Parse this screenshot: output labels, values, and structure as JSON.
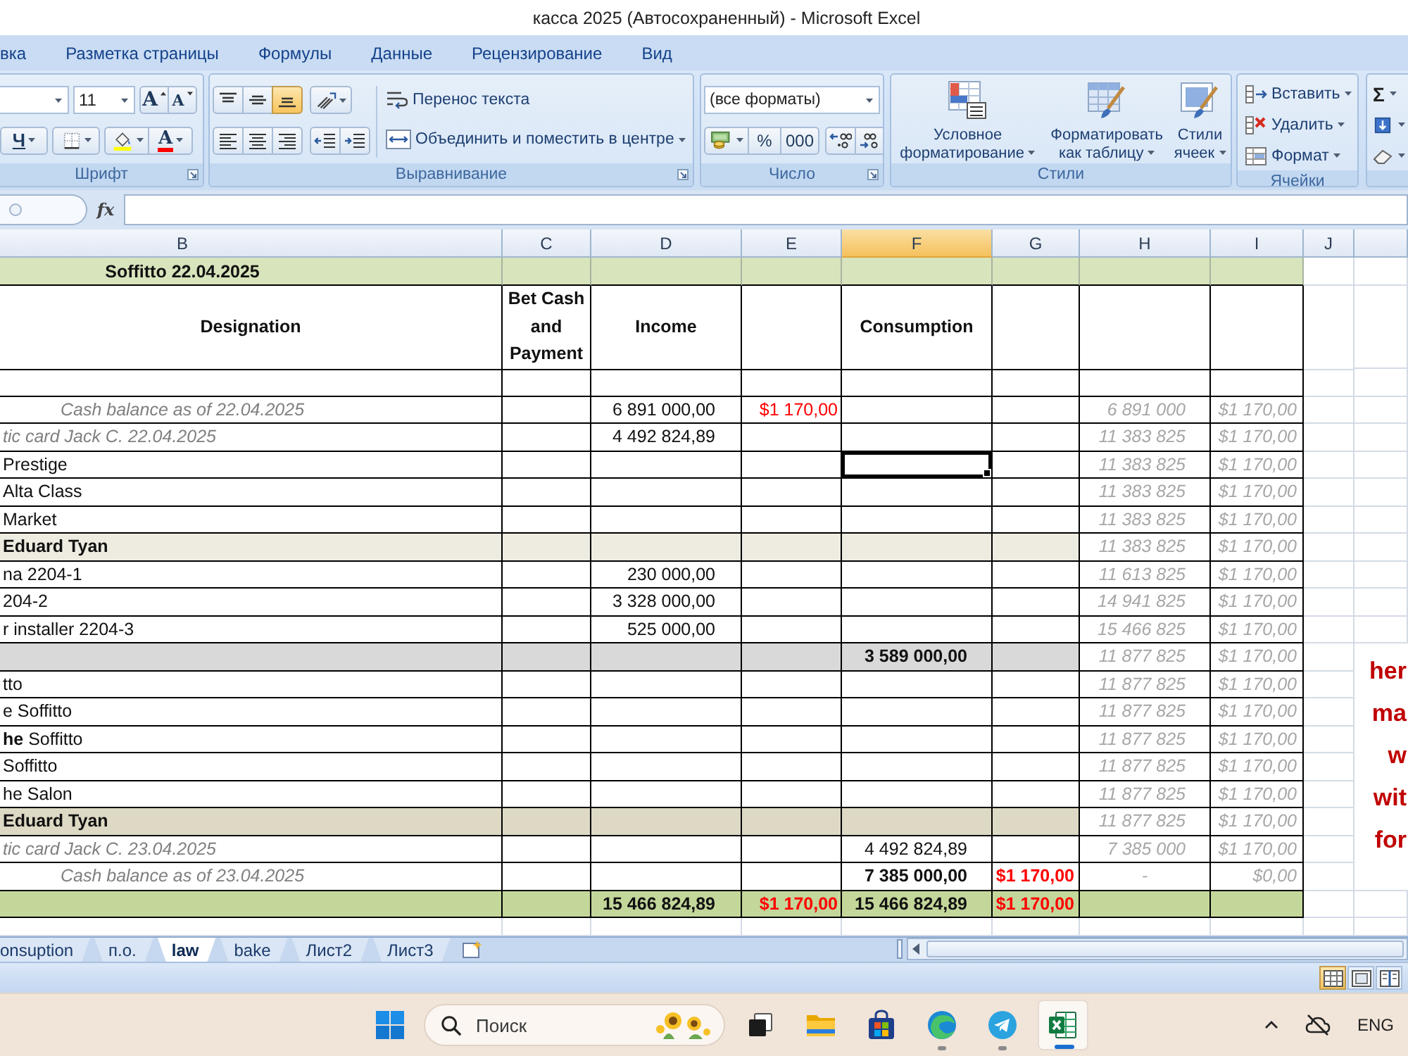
{
  "window": {
    "title": "касса 2025 (Автосохраненный) - Microsoft Excel"
  },
  "ribbon_tabs": [
    {
      "label": "вка",
      "selected": false
    },
    {
      "label": "Разметка страницы",
      "selected": false
    },
    {
      "label": "Формулы",
      "selected": false
    },
    {
      "label": "Данные",
      "selected": false
    },
    {
      "label": "Рецензирование",
      "selected": false
    },
    {
      "label": "Вид",
      "selected": false
    }
  ],
  "ribbon": {
    "font_group": {
      "label": "Шрифт",
      "size": "11",
      "grow_button": "A",
      "shrink_button": "A",
      "underline_button": "Ч",
      "font_color_button": "A"
    },
    "alignment_group": {
      "label": "Выравнивание",
      "vertical_buttons": [
        {
          "kind": "top",
          "selected": false
        },
        {
          "kind": "middle",
          "selected": false
        },
        {
          "kind": "bottom",
          "selected": true
        }
      ],
      "wrap_text": "Перенос текста",
      "merge": "Объединить и поместить в центре"
    },
    "number_group": {
      "label": "Число",
      "format": "(все форматы)",
      "percent_button": "%",
      "thousands_button": "000"
    },
    "styles_group": {
      "label": "Стили",
      "buttons": [
        {
          "kind": "conditional",
          "label": "Условное форматирование"
        },
        {
          "kind": "table",
          "label": "Форматировать как таблицу"
        },
        {
          "kind": "cell",
          "label": "Стили ячеек"
        }
      ]
    },
    "cells_group": {
      "label": "Ячейки",
      "buttons": [
        {
          "kind": "insert",
          "label": "Вставить"
        },
        {
          "kind": "delete",
          "label": "Удалить"
        },
        {
          "kind": "format",
          "label": "Формат"
        }
      ]
    },
    "editing_group": {
      "sum_button": "Σ"
    }
  },
  "formula_bar": {
    "function_button": "fx"
  },
  "sheet": {
    "columns": [
      {
        "label": "B",
        "selected": false
      },
      {
        "label": "C",
        "selected": false
      },
      {
        "label": "D",
        "selected": false
      },
      {
        "label": "E",
        "selected": false
      },
      {
        "label": "F",
        "selected": true
      },
      {
        "label": "G",
        "selected": false
      },
      {
        "label": "H",
        "selected": false
      },
      {
        "label": "I",
        "selected": false
      },
      {
        "label": "J",
        "selected": false
      }
    ],
    "rows": [
      {
        "kind": "title",
        "color": "#d8e4bc",
        "selected": false,
        "cells": {
          "designation": "Soffitto 22.04.2025"
        }
      },
      {
        "kind": "header",
        "selected": false,
        "cells": {
          "designation": "Designation",
          "bet_cash_and_payment": "Bet Cash and Payment",
          "income": "Income",
          "consumption": "Consumption"
        }
      },
      {
        "kind": "blank",
        "selected": false
      },
      {
        "kind": "opening",
        "selected": false,
        "cells": {
          "designation": "Cash balance as of 22.04.2025",
          "income": "6 891 000,00",
          "column_e": "$1 170,00",
          "column_h": "6 891 000",
          "column_i": "$1 170,00"
        }
      },
      {
        "kind": "card",
        "selected": false,
        "cells": {
          "designation": "tic card Jack C. 22.04.2025",
          "income": "4 492 824,89",
          "column_h": "11 383 825",
          "column_i": "$1 170,00"
        }
      },
      {
        "kind": "item",
        "selected": true,
        "cells": {
          "designation": "Prestige",
          "column_h": "11 383 825",
          "column_i": "$1 170,00"
        }
      },
      {
        "kind": "item",
        "selected": false,
        "cells": {
          "designation": "Alta Class",
          "column_h": "11 383 825",
          "column_i": "$1 170,00"
        }
      },
      {
        "kind": "item",
        "selected": false,
        "cells": {
          "designation": "Market",
          "column_h": "11 383 825",
          "column_i": "$1 170,00"
        }
      },
      {
        "kind": "group",
        "color": "#eeece1",
        "selected": false,
        "cells": {
          "designation": "Eduard Tyan",
          "column_h": "11 383 825",
          "column_i": "$1 170,00"
        }
      },
      {
        "kind": "item",
        "selected": false,
        "cells": {
          "designation": "na 2204-1",
          "income": "230 000,00",
          "column_h": "11 613 825",
          "column_i": "$1 170,00"
        }
      },
      {
        "kind": "item",
        "selected": false,
        "cells": {
          "designation": "204-2",
          "income": "3 328 000,00",
          "column_h": "14 941 825",
          "column_i": "$1 170,00"
        }
      },
      {
        "kind": "item",
        "selected": false,
        "cells": {
          "designation": "r installer 2204-3",
          "income": "525 000,00",
          "column_h": "15 466 825",
          "column_i": "$1 170,00"
        }
      },
      {
        "kind": "subtotal",
        "color": "#d9d9d9",
        "selected": false,
        "cells": {
          "consumption": "3 589 000,00",
          "column_h": "11 877 825",
          "column_i": "$1 170,00"
        }
      },
      {
        "kind": "item",
        "selected": false,
        "cells": {
          "designation": "tto",
          "column_h": "11 877 825",
          "column_i": "$1 170,00"
        }
      },
      {
        "kind": "item",
        "selected": false,
        "cells": {
          "designation": "e Soffitto",
          "column_h": "11 877 825",
          "column_i": "$1 170,00"
        }
      },
      {
        "kind": "item",
        "selected": false,
        "cells": {
          "designation": "**he** Soffitto",
          "column_h": "11 877 825",
          "column_i": "$1 170,00"
        }
      },
      {
        "kind": "item",
        "selected": false,
        "cells": {
          "designation": "Soffitto",
          "column_h": "11 877 825",
          "column_i": "$1 170,00"
        }
      },
      {
        "kind": "item",
        "selected": false,
        "cells": {
          "designation": "he Salon",
          "column_h": "11 877 825",
          "column_i": "$1 170,00"
        }
      },
      {
        "kind": "group",
        "color": "#ddd9c4",
        "selected": false,
        "cells": {
          "designation": "Eduard Tyan",
          "column_h": "11 877 825",
          "column_i": "$1 170,00"
        }
      },
      {
        "kind": "card",
        "selected": false,
        "cells": {
          "designation": "tic card Jack C. 23.04.2025",
          "consumption": "4 492 824,89",
          "column_h": "7 385 000",
          "column_i": "$1 170,00"
        }
      },
      {
        "kind": "closing",
        "selected": false,
        "cells": {
          "designation": "Cash balance as of 23.04.2025",
          "consumption": "7 385 000,00",
          "column_g": "$1 170,00",
          "column_h": "-",
          "column_i": "$0,00"
        }
      },
      {
        "kind": "total",
        "color": "#c4d79b",
        "selected": false,
        "cells": {
          "income": "15 466 824,89",
          "column_e": "$1 170,00",
          "consumption": "15 466 824,89",
          "column_g": "$1 170,00"
        }
      }
    ],
    "side_note": [
      "her",
      "ma",
      "w",
      "wit",
      "for"
    ]
  },
  "sheet_tabs": [
    {
      "label": "onsuption",
      "selected": false
    },
    {
      "label": "п.о.",
      "selected": false
    },
    {
      "label": "law",
      "selected": true
    },
    {
      "label": "bake",
      "selected": false
    },
    {
      "label": "Лист2",
      "selected": false
    },
    {
      "label": "Лист3",
      "selected": false
    }
  ],
  "status_bar": {
    "view_buttons": [
      {
        "kind": "normal",
        "selected": true
      },
      {
        "kind": "page_layout",
        "selected": false
      },
      {
        "kind": "page_break",
        "selected": false
      }
    ]
  },
  "taskbar": {
    "search": {
      "placeholder": "Поиск"
    },
    "apps": [
      {
        "kind": "task_view",
        "running": false,
        "selected": false
      },
      {
        "kind": "explorer",
        "running": false,
        "selected": false
      },
      {
        "kind": "store",
        "running": false,
        "selected": false
      },
      {
        "kind": "browser",
        "running": true,
        "selected": false
      },
      {
        "kind": "messenger",
        "running": true,
        "selected": false
      },
      {
        "kind": "spreadsheet",
        "running": true,
        "selected": true
      }
    ],
    "language": "ENG"
  }
}
